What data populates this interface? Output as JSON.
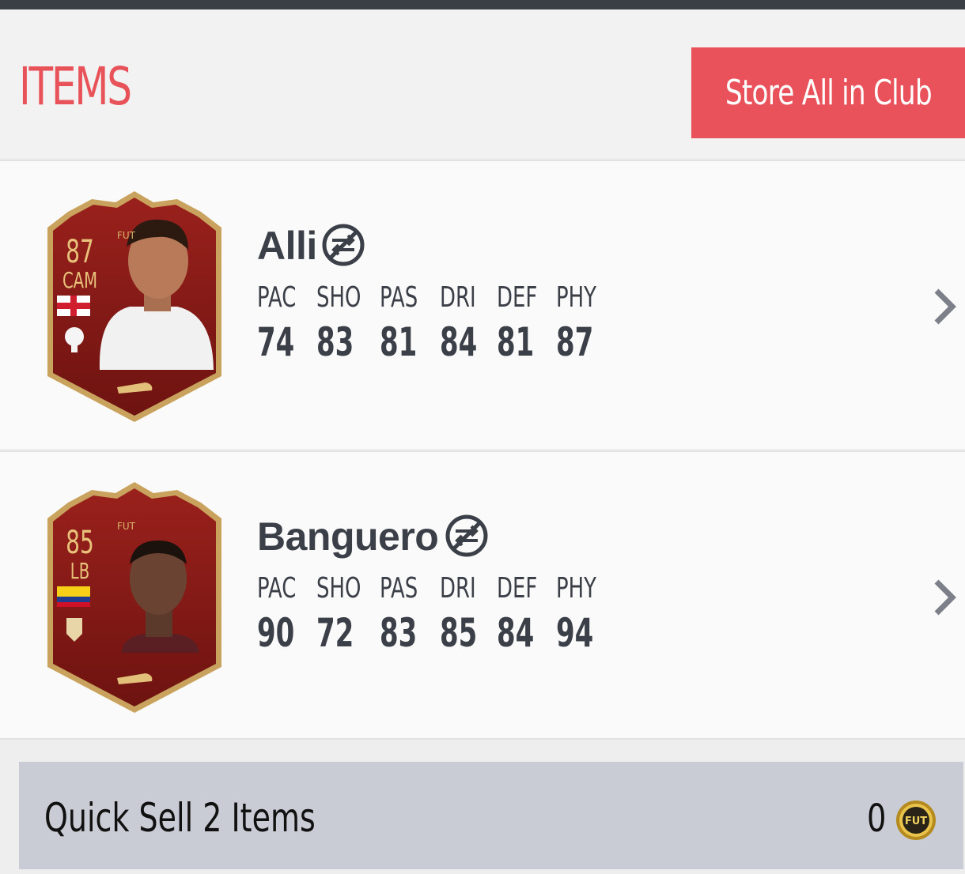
{
  "header": {
    "title": "ITEMS",
    "store_all_label": "Store All in Club"
  },
  "stat_labels": [
    "PAC",
    "SHO",
    "PAS",
    "DRI",
    "DEF",
    "PHY"
  ],
  "items": [
    {
      "name": "Alli",
      "rating": "87",
      "position": "CAM",
      "stats": [
        "74",
        "83",
        "81",
        "84",
        "81",
        "87"
      ],
      "untradeable_icon": "untradeable-icon",
      "flag": "England"
    },
    {
      "name": "Banguero",
      "rating": "85",
      "position": "LB",
      "stats": [
        "90",
        "72",
        "83",
        "85",
        "84",
        "94"
      ],
      "untradeable_icon": "untradeable-icon",
      "flag": "Colombia"
    }
  ],
  "quick_sell": {
    "label": "Quick Sell 2 Items",
    "amount": "0",
    "coin_icon": "fut-coin-icon",
    "coin_text": "FUT"
  },
  "colors": {
    "accent": "#e9525a",
    "card_red": "#8e1b18",
    "card_gold": "#d9b36a",
    "text_dark": "#3b3f47",
    "quick_sell_bg": "#c9cbd5"
  }
}
